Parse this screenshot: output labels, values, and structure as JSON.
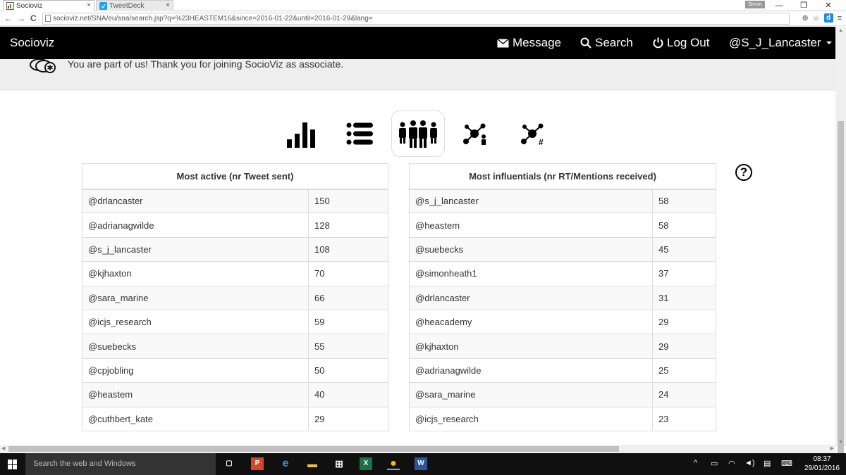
{
  "browser": {
    "tabs": [
      {
        "label": "Socioviz",
        "active": true
      },
      {
        "label": "TweetDeck",
        "active": false
      }
    ],
    "user_chip": "Simon",
    "url": "socioviz.net/SNA/eu/sna/search.jsp?q=%23HEASTEM16&since=2016-01-22&until=2016-01-29&lang=",
    "close_glyph": "×",
    "back_glyph": "←",
    "forward_glyph": "→",
    "reload_glyph": "C",
    "min_glyph": "—",
    "restore_glyph": "❐",
    "winclose_glyph": "✕",
    "zoom_glyph": "⊕",
    "star_glyph": "☆",
    "ext_glyph": "d",
    "menu_glyph": "≡"
  },
  "navbar": {
    "brand": "Socioviz",
    "message": "Message",
    "search": "Search",
    "logout": "Log Out",
    "user": "@S_J_Lancaster"
  },
  "notice": {
    "text": "You are part of us! Thank you for joining SocioViz as associate."
  },
  "views": {
    "icons": [
      "bar-chart-icon",
      "list-icon",
      "people-icon",
      "network-user-icon",
      "network-hashtag-icon"
    ],
    "active": "people-icon",
    "hashtag_glyph": "#"
  },
  "help_glyph": "?",
  "most_active": {
    "header": "Most active (nr Tweet sent)",
    "rows": [
      {
        "user": "@drlancaster",
        "count": "150"
      },
      {
        "user": "@adrianagwilde",
        "count": "128"
      },
      {
        "user": "@s_j_lancaster",
        "count": "108"
      },
      {
        "user": "@kjhaxton",
        "count": "70"
      },
      {
        "user": "@sara_marine",
        "count": "66"
      },
      {
        "user": "@icjs_research",
        "count": "59"
      },
      {
        "user": "@suebecks",
        "count": "55"
      },
      {
        "user": "@cpjobling",
        "count": "50"
      },
      {
        "user": "@heastem",
        "count": "40"
      },
      {
        "user": "@cuthbert_kate",
        "count": "29"
      }
    ]
  },
  "most_influential": {
    "header": "Most influentials (nr RT/Mentions received)",
    "rows": [
      {
        "user": "@s_j_lancaster",
        "count": "58"
      },
      {
        "user": "@heastem",
        "count": "58"
      },
      {
        "user": "@suebecks",
        "count": "45"
      },
      {
        "user": "@simonheath1",
        "count": "37"
      },
      {
        "user": "@drlancaster",
        "count": "31"
      },
      {
        "user": "@heacademy",
        "count": "29"
      },
      {
        "user": "@kjhaxton",
        "count": "29"
      },
      {
        "user": "@adrianagwilde",
        "count": "25"
      },
      {
        "user": "@sara_marine",
        "count": "24"
      },
      {
        "user": "@icjs_research",
        "count": "23"
      }
    ]
  },
  "scroll": {
    "up_glyph": "▲",
    "down_glyph": "▼",
    "left_glyph": "◀",
    "right_glyph": "▶"
  },
  "taskbar": {
    "search_placeholder": "Search the web and Windows",
    "apps": {
      "taskview": "▢",
      "powerpoint": "P",
      "edge": "e",
      "explorer": "▬",
      "store": "⊞",
      "excel": "X",
      "chrome": "●",
      "word": "W"
    },
    "tray": {
      "chevron": "^",
      "battery": "▭",
      "wifi": "◠",
      "volume": "◄)",
      "notifications": "▤",
      "keyboard": "⌨"
    },
    "time": "08:37",
    "date": "29/01/2016"
  }
}
